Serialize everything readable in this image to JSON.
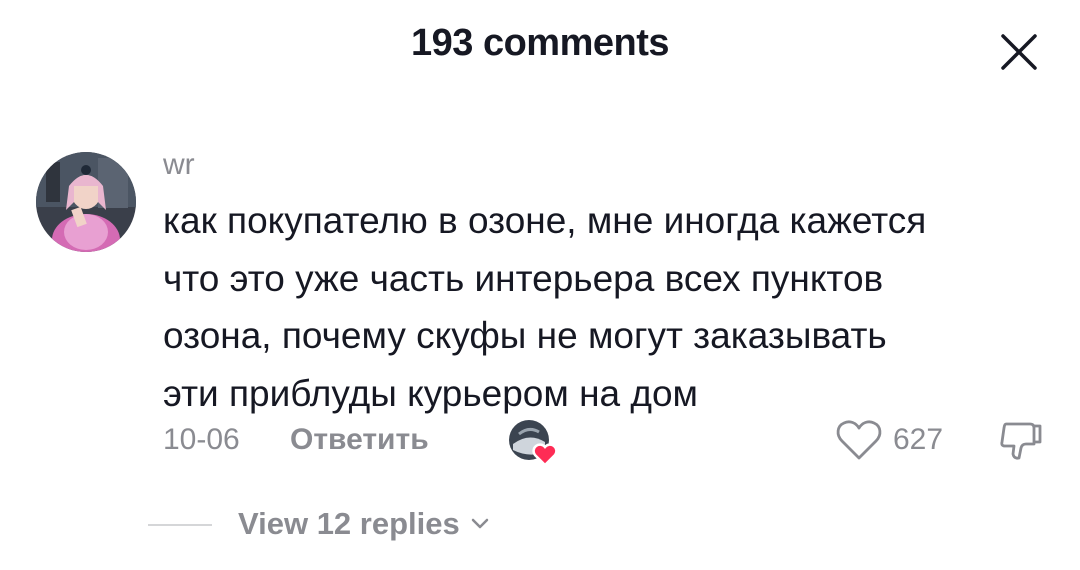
{
  "header": {
    "title": "193 comments",
    "close_icon": "close-icon"
  },
  "comment": {
    "username": "wr",
    "avatar_icon": "avatar",
    "lines": [
      "как покупателю в озоне, мне иногда кажется",
      "что это уже часть интерьера всех пунктов",
      "озона, почему скуфы не могут заказывать",
      "эти приблуды курьером на дом"
    ],
    "date": "10-06",
    "reply_label": "Ответить",
    "like_count": "627",
    "like_icon": "heart-outline-icon",
    "dislike_icon": "thumbs-down-icon",
    "creator_liked_icon": "creator-liked-badge"
  },
  "replies": {
    "label": "View 12 replies",
    "icon": "chevron-down-icon"
  }
}
